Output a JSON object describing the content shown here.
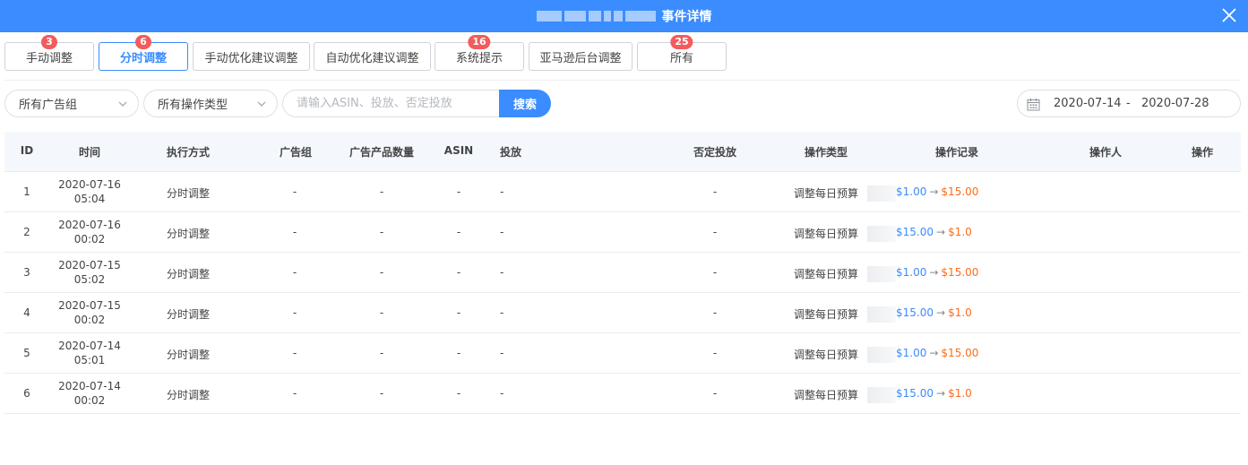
{
  "header": {
    "title": "事件详情",
    "close_icon": "close-icon"
  },
  "tabs": [
    {
      "label": "手动调整",
      "badge": "3",
      "active": false
    },
    {
      "label": "分时调整",
      "badge": "6",
      "active": true
    },
    {
      "label": "手动优化建议调整",
      "badge": "",
      "active": false
    },
    {
      "label": "自动优化建议调整",
      "badge": "",
      "active": false
    },
    {
      "label": "系统提示",
      "badge": "16",
      "active": false
    },
    {
      "label": "亚马逊后台调整",
      "badge": "",
      "active": false
    },
    {
      "label": "所有",
      "badge": "25",
      "active": false
    }
  ],
  "filters": {
    "ad_group_select": "所有广告组",
    "op_type_select": "所有操作类型",
    "search_placeholder": "请输入ASIN、投放、否定投放",
    "search_button": "搜索",
    "date_start": "2020-07-14",
    "date_separator": "-",
    "date_end": "2020-07-28"
  },
  "table": {
    "columns": [
      "ID",
      "时间",
      "执行方式",
      "广告组",
      "广告产品数量",
      "ASIN",
      "投放",
      "否定投放",
      "操作类型",
      "操作记录",
      "操作人",
      "操作"
    ],
    "rows": [
      {
        "id": "1",
        "date": "2020-07-16",
        "time": "05:04",
        "method": "分时调整",
        "ad_group": "-",
        "product_count": "-",
        "asin": "-",
        "targeting": "-",
        "negative": "-",
        "op_type": "调整每日预算",
        "from": "$1.00",
        "arrow": "→",
        "to": "$15.00"
      },
      {
        "id": "2",
        "date": "2020-07-16",
        "time": "00:02",
        "method": "分时调整",
        "ad_group": "-",
        "product_count": "-",
        "asin": "-",
        "targeting": "-",
        "negative": "-",
        "op_type": "调整每日预算",
        "from": "$15.00",
        "arrow": "→",
        "to": "$1.0"
      },
      {
        "id": "3",
        "date": "2020-07-15",
        "time": "05:02",
        "method": "分时调整",
        "ad_group": "-",
        "product_count": "-",
        "asin": "-",
        "targeting": "-",
        "negative": "-",
        "op_type": "调整每日预算",
        "from": "$1.00",
        "arrow": "→",
        "to": "$15.00"
      },
      {
        "id": "4",
        "date": "2020-07-15",
        "time": "00:02",
        "method": "分时调整",
        "ad_group": "-",
        "product_count": "-",
        "asin": "-",
        "targeting": "-",
        "negative": "-",
        "op_type": "调整每日预算",
        "from": "$15.00",
        "arrow": "→",
        "to": "$1.0"
      },
      {
        "id": "5",
        "date": "2020-07-14",
        "time": "05:01",
        "method": "分时调整",
        "ad_group": "-",
        "product_count": "-",
        "asin": "-",
        "targeting": "-",
        "negative": "-",
        "op_type": "调整每日预算",
        "from": "$1.00",
        "arrow": "→",
        "to": "$15.00"
      },
      {
        "id": "6",
        "date": "2020-07-14",
        "time": "00:02",
        "method": "分时调整",
        "ad_group": "-",
        "product_count": "-",
        "asin": "-",
        "targeting": "-",
        "negative": "-",
        "op_type": "调整每日预算",
        "from": "$15.00",
        "arrow": "→",
        "to": "$1.0"
      }
    ]
  }
}
